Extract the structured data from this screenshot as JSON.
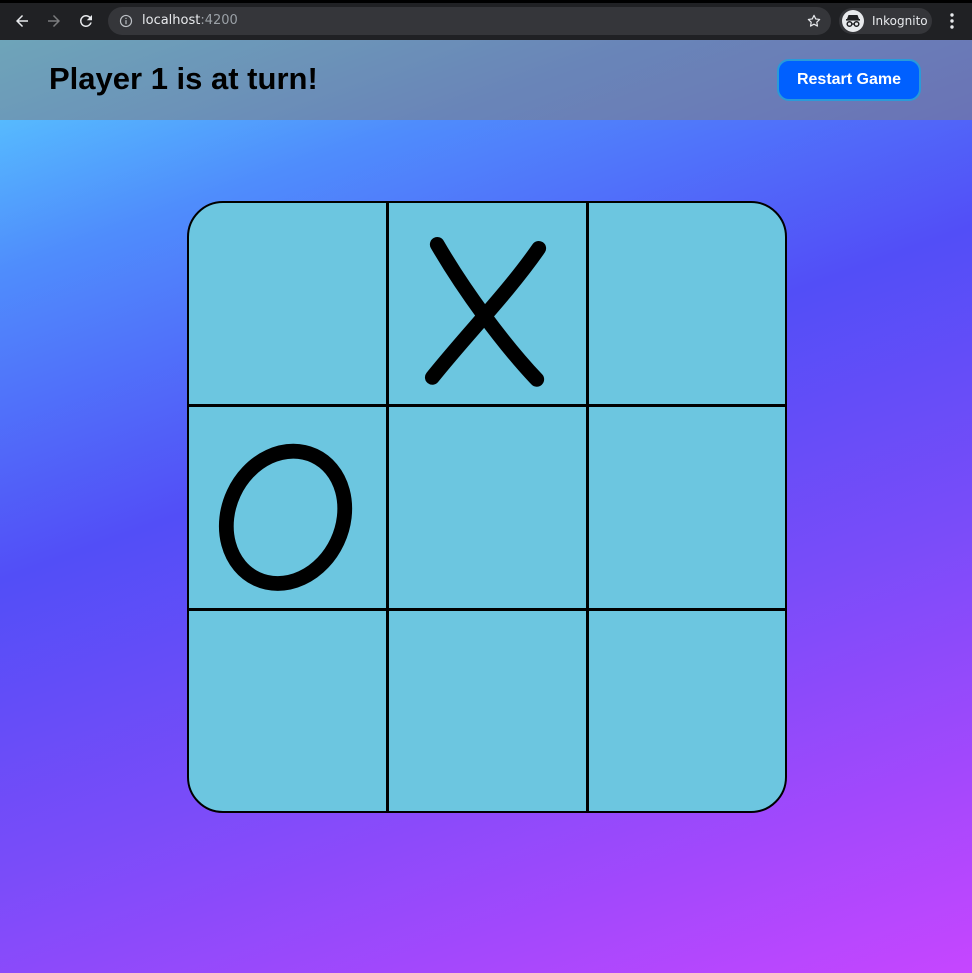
{
  "browser": {
    "url_host": "localhost",
    "url_port": ":4200",
    "profile_label": "Inkognito",
    "icons": {
      "back": "back-arrow-icon",
      "forward": "forward-arrow-icon",
      "reload": "reload-icon",
      "info": "info-icon",
      "bookmark": "star-icon",
      "incognito": "incognito-icon",
      "menu": "kebab-menu-icon"
    }
  },
  "header": {
    "status_text": "Player 1 is at turn!",
    "restart_label": "Restart Game"
  },
  "board": {
    "cells": [
      "",
      "X",
      "",
      "O",
      "",
      "",
      "",
      "",
      ""
    ]
  },
  "colors": {
    "board_fill": "#6cc6e0",
    "button_blue": "#0060ff",
    "gradient_start": "#5ad2ff",
    "gradient_mid": "#524ef7",
    "gradient_end": "#c646ff"
  }
}
